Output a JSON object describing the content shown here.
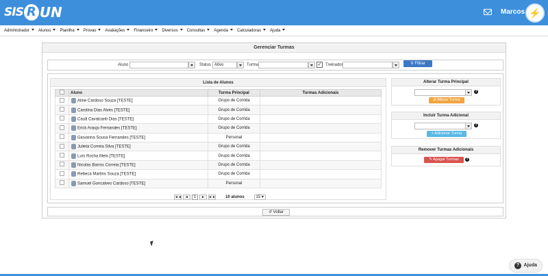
{
  "header": {
    "logo_left": "SIS",
    "logo_mid": "R",
    "logo_right": "UN",
    "user_name": "Marcos"
  },
  "menu": [
    "Administrador",
    "Alunos",
    "Planilha",
    "Provas",
    "Avaliações",
    "Financeiro",
    "Diversos",
    "Consultas",
    "Agenda",
    "Calculadoras",
    "Ajuda"
  ],
  "page_title": "Gerenciar Turmas",
  "filters": {
    "aluno_label": "Aluno",
    "status_label": "Status",
    "status_value": "Ativo",
    "turma_label": "Turma",
    "treinador_label": "Treinador",
    "filter_button": "Filtrar",
    "search_icon": "search-icon"
  },
  "list": {
    "title": "Lista de Alunos",
    "columns": [
      "Aluno",
      "Turma Principal",
      "Turmas Adicionais"
    ],
    "rows": [
      {
        "name": "Aline Cardoso Souza [TESTE]",
        "turma": "Grupo de Corrida",
        "adicionais": ""
      },
      {
        "name": "Carolina Dias Alves [TESTE]",
        "turma": "Grupo de Corrida",
        "adicionais": ""
      },
      {
        "name": "Cauã Cavalcanti Dias [TESTE]",
        "turma": "Grupo de Corrida",
        "adicionais": ""
      },
      {
        "name": "Erick Araujo Fernandes [TESTE]",
        "turma": "Grupo de Corrida",
        "adicionais": ""
      },
      {
        "name": "Giovanna Sousa Fernandes [TESTE]",
        "turma": "Personal",
        "adicionais": ""
      },
      {
        "name": "Julieta Correia Silva [TESTE]",
        "turma": "Grupo de Corrida",
        "adicionais": ""
      },
      {
        "name": "Luís Rocha Melo [TESTE]",
        "turma": "Grupo de Corrida",
        "adicionais": ""
      },
      {
        "name": "Nicolas Barros Correia [TESTE]",
        "turma": "Grupo de Corrida",
        "adicionais": ""
      },
      {
        "name": "Rebeca Martins Souza [TESTE]",
        "turma": "Grupo de Corrida",
        "adicionais": ""
      },
      {
        "name": "Samuel Goncalves Cardoso [TESTE]",
        "turma": "Personal",
        "adicionais": ""
      }
    ],
    "pager": {
      "first": "◄◄",
      "prev": "◄",
      "page": "1",
      "next": "►",
      "last": "►►",
      "count_label": "10 alunos",
      "page_size": "15"
    }
  },
  "side": {
    "alterar": {
      "title": "Alterar Turma Principal",
      "button": "Alterar Turma",
      "help": "?"
    },
    "incluir": {
      "title": "Incluir Turma Adicional",
      "button": "+ Adicionar Turma",
      "help": "?"
    },
    "remover": {
      "title": "Remover Turmas Adicionais",
      "button": "Apagar Turmas",
      "help": "?"
    }
  },
  "footer": {
    "back": "Voltar"
  },
  "help_widget": {
    "label": "Ajuda",
    "icon": "?"
  },
  "colors": {
    "brand": "#3d8fdc",
    "filter_btn": "#3b79c7",
    "alterar_btn": "#f0a540",
    "incluir_btn": "#5bb8e6",
    "remover_btn": "#d9534f"
  }
}
